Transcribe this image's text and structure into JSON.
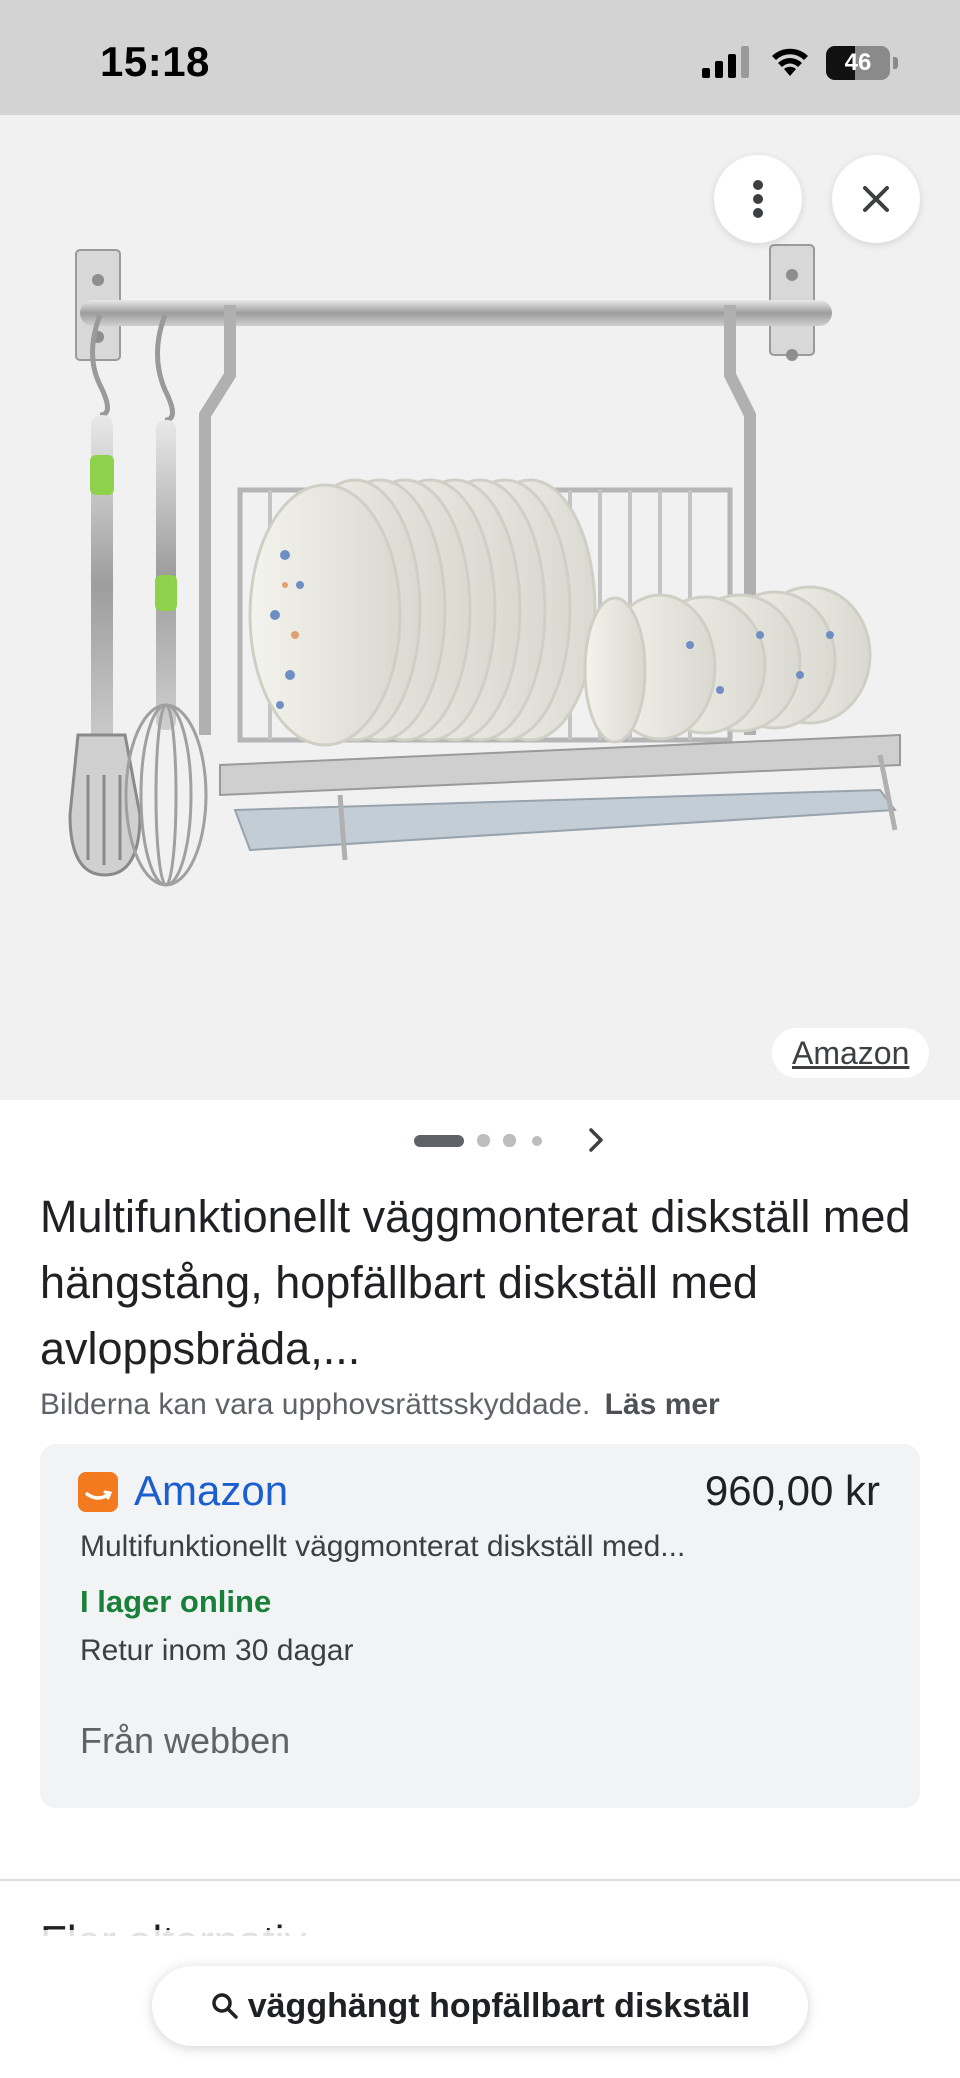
{
  "status_bar": {
    "time": "15:18",
    "battery_level": "46",
    "battery_fraction": 0.46
  },
  "image_viewer": {
    "source_chip": "Amazon",
    "page_count": 4,
    "current_page": 1,
    "icons": {
      "more": "more-vert-icon",
      "close": "close-icon",
      "next": "chevron-right-icon"
    }
  },
  "product": {
    "title": "Multifunktionellt väggmonterat diskställ med hängstång, hopfällbart diskställ med avloppsbräda,...",
    "copyright_notice": "Bilderna kan vara upphovsrättsskyddade.",
    "read_more": "Läs mer"
  },
  "offer": {
    "merchant": "Amazon",
    "price": "960,00 kr",
    "description": "Multifunktionellt väggmonterat diskställ med...",
    "stock": "I lager online",
    "returns": "Retur inom 30 dagar",
    "source": "Från webben",
    "colors": {
      "merchant_link": "#1a5ecf",
      "stock": "#188038",
      "logo": "#f47a20"
    }
  },
  "next_section": {
    "title_partial": "Fler alternativ"
  },
  "search": {
    "query": "vägghängt hopfällbart diskställ",
    "icon": "search-icon"
  }
}
